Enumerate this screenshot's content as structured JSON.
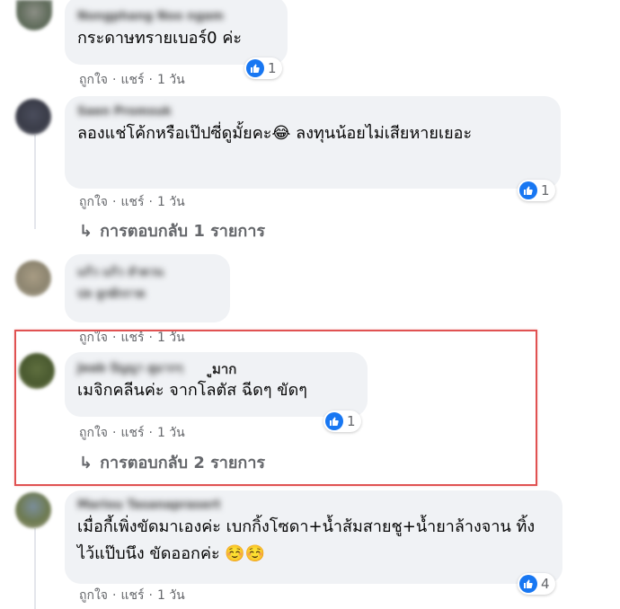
{
  "comments": [
    {
      "author": "Nongphang Noo ngam",
      "text": "กระดาษทรายเบอร์0 ค่ะ",
      "like_label": "ถูกใจ",
      "share_label": "แชร์",
      "time": "1 วัน",
      "reaction_count": "1"
    },
    {
      "author": "Saen Promsuk",
      "text": "ลองแช่โค้กหรือเป๊ปซี่ดูมั้ยคะ😂 ลงทุนน้อยไม่เสียหายเยอะ",
      "like_label": "ถูกใจ",
      "share_label": "แชร์",
      "time": "1 วัน",
      "reaction_count": "1",
      "replies_label": "การตอบกลับ 1 รายการ"
    },
    {
      "author": "แก้ว แก้ว ลำดวน",
      "text_blurred": "ปล ลูกผักกาด",
      "like_label": "ถูกใจ",
      "share_label": "แชร์",
      "time": "1 วัน"
    },
    {
      "author": "Jeab ปัญญา ดูมากๆ",
      "author_visible_tail": "ูมาก",
      "text": "เมจิกคลีนค่ะ จากโลตัส ฉีดๆ ขัดๆ",
      "like_label": "ถูกใจ",
      "share_label": "แชร์",
      "time": "1 วัน",
      "reaction_count": "1",
      "replies_label": "การตอบกลับ 2 รายการ"
    },
    {
      "author": "Mariou Tasanaprasert",
      "text": "เมื่อกี้เพิ่งขัดมาเองค่ะ เบกกิ้งโซดา+น้ำส้มสายชู+น้ำยาล้างจาน ทิ้งไว้แป๊บนึง ขัดออกค่ะ ☺️☺️",
      "like_label": "ถูกใจ",
      "share_label": "แชร์",
      "time": "1 วัน",
      "reaction_count": "4"
    }
  ],
  "colors": {
    "bubble": "#f0f2f5",
    "like_blue": "#1877f2",
    "meta_gray": "#65676b",
    "highlight_red": "#e05252"
  },
  "icons": {
    "like": "thumbs-up-icon",
    "reply": "reply-arrow-icon"
  }
}
